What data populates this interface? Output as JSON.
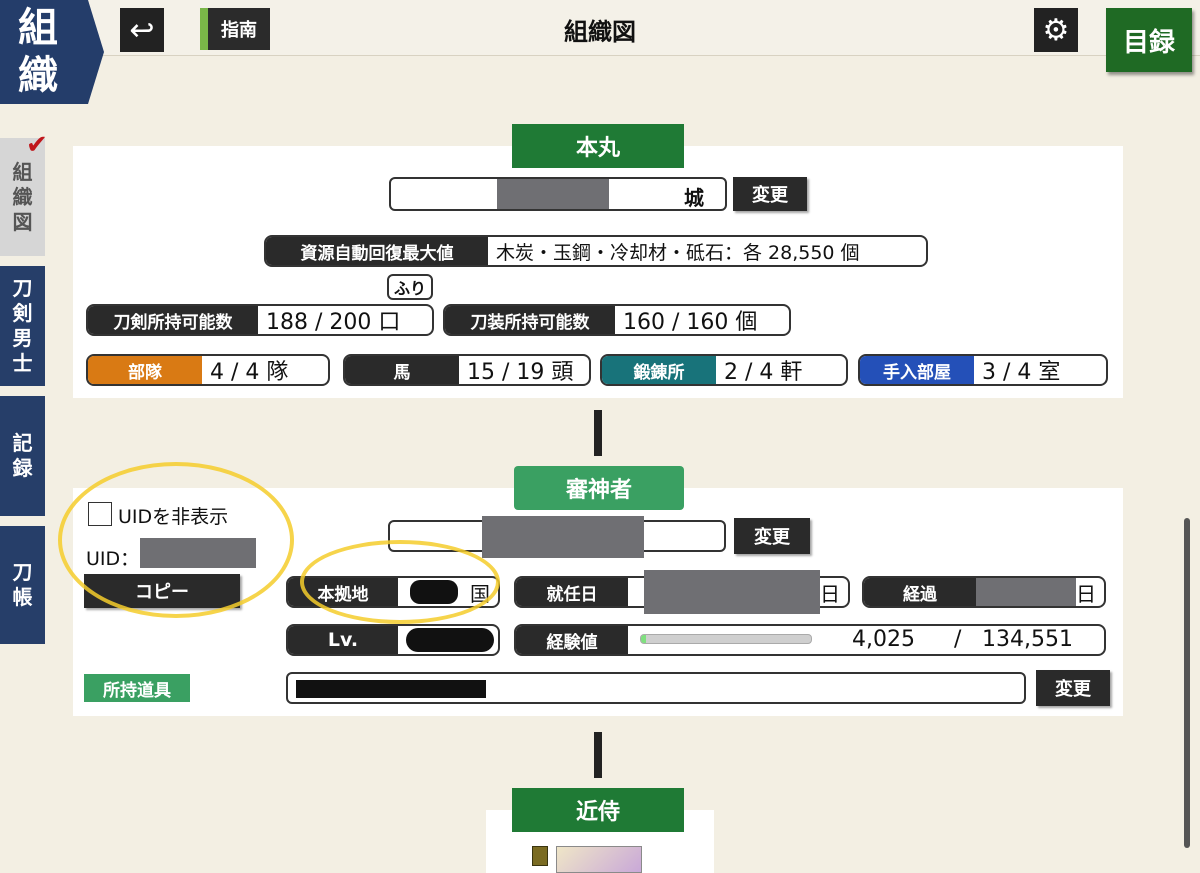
{
  "header": {
    "corner_title_1": "組",
    "corner_title_2": "織",
    "back_icon": "↩",
    "guide_label": "指南",
    "title": "組織図",
    "settings_icon": "⚙",
    "catalog_label": "目録"
  },
  "sidebar": {
    "checkmark": "✔",
    "tabs": [
      {
        "label": "組\n織\n図"
      },
      {
        "label": "刀\n剣\n男\n士"
      },
      {
        "label": "記\n録"
      },
      {
        "label": "刀\n帳"
      }
    ]
  },
  "honmaru": {
    "title": "本丸",
    "castle_suffix": "城",
    "change_label": "変更",
    "resource_label": "資源自動回復最大値",
    "resource_value": "木炭・玉鋼・冷却材・砥石：各 28,550 個",
    "furi_tag": "ふり",
    "swords_label": "刀剣所持可能数",
    "swords_value": "188 / 200 口",
    "equip_label": "刀装所持可能数",
    "equip_value": "160 / 160 個",
    "units_label": "部隊",
    "units_value": "4 / 4 隊",
    "horses_label": "馬",
    "horses_value": "15 / 19 頭",
    "forge_label": "鍛錬所",
    "forge_value": "2 / 4 軒",
    "repair_label": "手入部屋",
    "repair_value": "3 / 4 室"
  },
  "saniwa": {
    "title": "審神者",
    "hide_uid_label": "UIDを非表示",
    "uid_label": "UID：",
    "copy_label": "コピー",
    "change_label": "変更",
    "base_label": "本拠地",
    "base_suffix": "国",
    "appointed_label": "就任日",
    "appointed_suffix": "日",
    "elapsed_label": "経過",
    "elapsed_suffix": "日",
    "level_label": "Lv.",
    "exp_label": "経験値",
    "exp_current": "4,025",
    "exp_sep": "/",
    "exp_total": "134,551",
    "exp_progress": 0.03,
    "items_label": "所持道具",
    "items_change_label": "変更"
  },
  "kinji": {
    "title": "近侍"
  },
  "colors": {
    "units": "#d97a14",
    "forge": "#18737a",
    "repair": "#2450b8",
    "dark_label": "#2a2a2a",
    "band_green": "#1f7a35"
  }
}
